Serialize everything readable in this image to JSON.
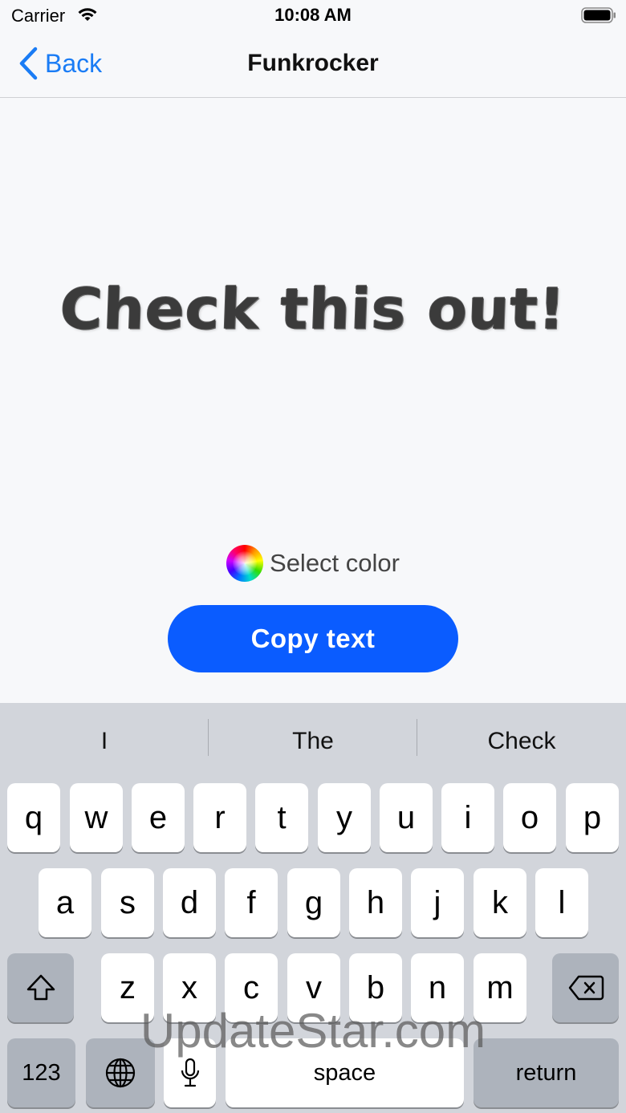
{
  "status_bar": {
    "carrier": "Carrier",
    "time": "10:08 AM",
    "wifi_icon": "wifi-icon",
    "battery_icon": "battery-icon"
  },
  "nav": {
    "back_label": "Back",
    "title": "Funkrocker"
  },
  "preview": {
    "text": "Check this out!"
  },
  "controls": {
    "select_color_label": "Select color",
    "copy_button_label": "Copy text"
  },
  "keyboard": {
    "suggestions": [
      "I",
      "The",
      "Check"
    ],
    "row1": [
      "q",
      "w",
      "e",
      "r",
      "t",
      "y",
      "u",
      "i",
      "o",
      "p"
    ],
    "row2": [
      "a",
      "s",
      "d",
      "f",
      "g",
      "h",
      "j",
      "k",
      "l"
    ],
    "row3": [
      "z",
      "x",
      "c",
      "v",
      "b",
      "n",
      "m"
    ],
    "numbers_label": "123",
    "space_label": "space",
    "return_label": "return"
  },
  "watermark": "UpdateStar.com",
  "colors": {
    "accent_blue": "#0a5cff",
    "nav_link": "#1a7cf5",
    "keyboard_bg": "#d2d5db"
  }
}
